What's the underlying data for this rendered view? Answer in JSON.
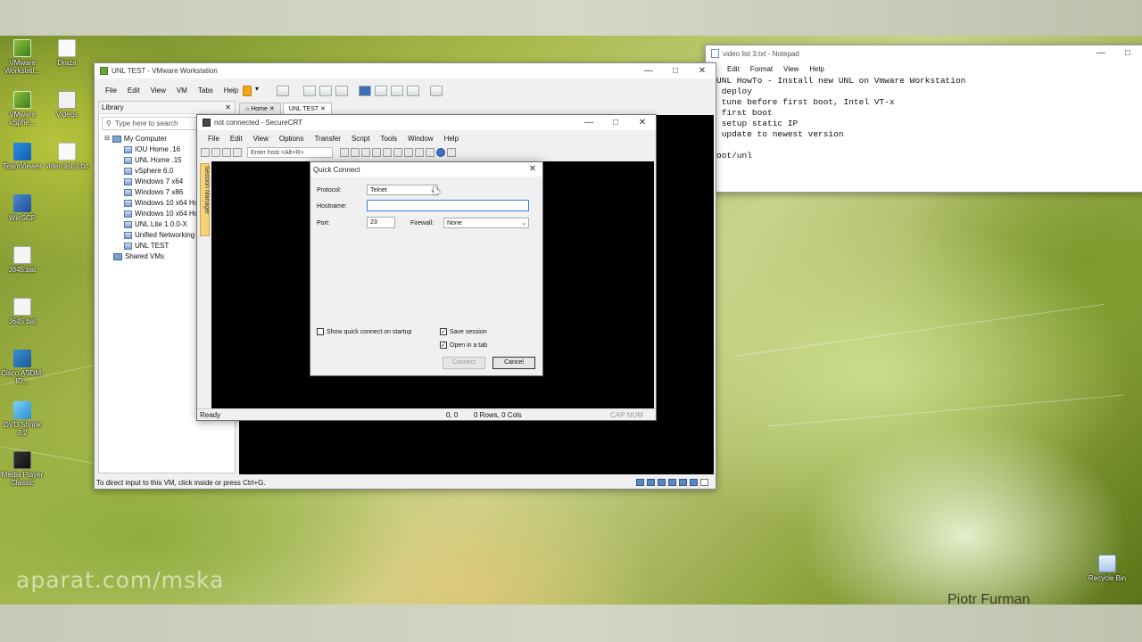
{
  "desktop": {
    "icons": [
      {
        "label": "VMware Workstati...",
        "icon": "vmware-icon"
      },
      {
        "label": "Draza",
        "icon": "document-icon"
      },
      {
        "label": "VMware vSphe...",
        "icon": "vsphere-icon"
      },
      {
        "label": "Videos",
        "icon": "folder-icon"
      },
      {
        "label": "TeamViewer",
        "icon": "teamviewer-icon"
      },
      {
        "label": "video list 3.txt",
        "icon": "text-file-icon"
      },
      {
        "label": "WinSCP",
        "icon": "winscp-icon"
      },
      {
        "label": "J845.bat",
        "icon": "batch-file-icon"
      },
      {
        "label": "J645.bat",
        "icon": "batch-file-icon"
      },
      {
        "label": "Cisco ASDM-ID...",
        "icon": "cisco-icon"
      },
      {
        "label": "DVD Shrink 3.2",
        "icon": "dvd-shrink-icon"
      },
      {
        "label": "Media Player Classic",
        "icon": "media-player-icon"
      },
      {
        "label": "Recycle Bin",
        "icon": "recycle-bin-icon"
      }
    ],
    "watermark": "aparat.com/mska",
    "author": "Piotr Furman"
  },
  "vmware": {
    "title": "UNL TEST - VMware Workstation",
    "menu": [
      "File",
      "Edit",
      "View",
      "VM",
      "Tabs",
      "Help"
    ],
    "library": {
      "title": "Library",
      "search_placeholder": "Type here to search",
      "root": "My Computer",
      "items": [
        "IOU Home .16",
        "UNL Home .15",
        "vSphere 6.0",
        "Windows 7 x64",
        "Windows 7 x86",
        "Windows 10 x64 Hc",
        "Windows 10 x64 Hc",
        "UNL Lite 1.0.0-X",
        "Unified Networking",
        "UNL TEST"
      ],
      "shared": "Shared VMs"
    },
    "tabs": [
      {
        "label": "Home"
      },
      {
        "label": "UNL TEST"
      }
    ],
    "status": "To direct input to this VM, click inside or press Ctrl+G."
  },
  "securecrt": {
    "title": "not connected - SecureCRT",
    "menu": [
      "File",
      "Edit",
      "View",
      "Options",
      "Transfer",
      "Script",
      "Tools",
      "Window",
      "Help"
    ],
    "host_placeholder": "Enter host <Alt+R>",
    "session_manager": "Session Manager",
    "status": {
      "ready": "Ready",
      "position": "0, 0",
      "size": "0 Rows, 0 Cols",
      "keys": "CAP NUM"
    }
  },
  "quick_connect": {
    "title": "Quick Connect",
    "protocol_label": "Protocol:",
    "protocol_value": "Telnet",
    "hostname_label": "Hostname:",
    "hostname_value": "",
    "port_label": "Port:",
    "port_value": "23",
    "firewall_label": "Firewall:",
    "firewall_value": "None",
    "show_on_startup": {
      "label": "Show quick connect on startup",
      "checked": false
    },
    "save_session": {
      "label": "Save session",
      "checked": true
    },
    "open_in_tab": {
      "label": "Open in a tab",
      "checked": true
    },
    "connect_label": "Connect",
    "cancel_label": "Cancel"
  },
  "notepad": {
    "title": "video list 3.txt - Notepad",
    "menu": [
      "Edit",
      "Format",
      "View",
      "Help"
    ],
    "lines": [
      "UNL HowTo - Install new UNL on Vmware Workstation",
      " deploy",
      " tune before first boot, Intel VT-x",
      " first boot",
      " setup static IP",
      " update to newest version",
      "",
      "oot/unl"
    ]
  }
}
